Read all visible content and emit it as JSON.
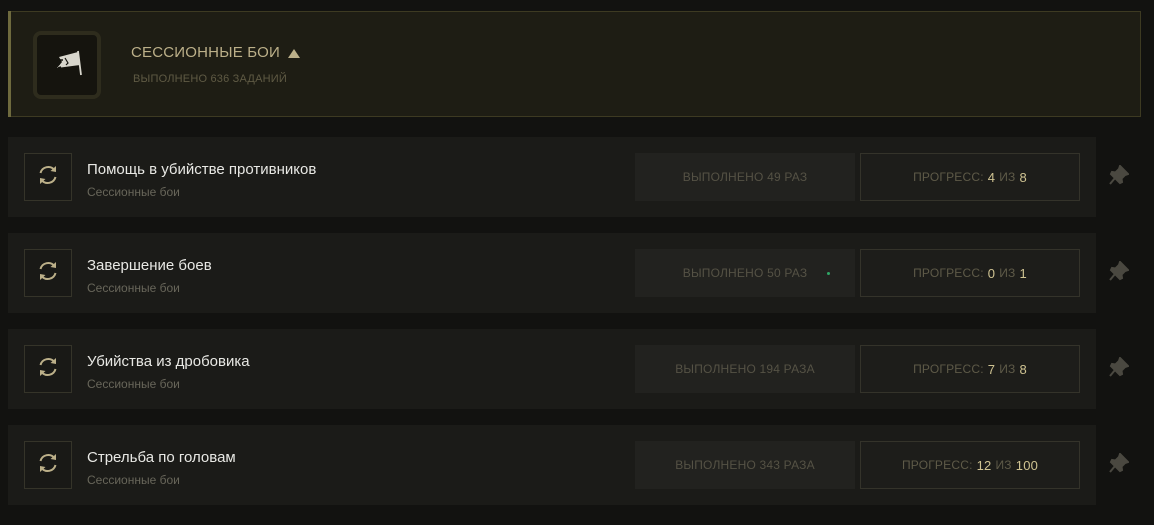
{
  "colors": {
    "accent_gold": "#bcb089",
    "progress_value": "#cfc392",
    "green_dot": "#2fa565"
  },
  "header": {
    "icon": "banner-flag-icon",
    "title": "СЕССИОННЫЕ БОИ",
    "subtitle": "ВЫПОЛНЕНО 636 ЗАДАНИЙ"
  },
  "tasks": [
    {
      "name": "Помощь в убийстве противников",
      "category": "Сессионные бои",
      "completed": "ВЫПОЛНЕНО 49 РАЗ",
      "progress_label": "ПРОГРЕСС:",
      "progress_current": "4",
      "progress_of": "ИЗ",
      "progress_total": "8",
      "new_indicator": false
    },
    {
      "name": "Завершение боев",
      "category": "Сессионные бои",
      "completed": "ВЫПОЛНЕНО 50 РАЗ",
      "progress_label": "ПРОГРЕСС:",
      "progress_current": "0",
      "progress_of": "ИЗ",
      "progress_total": "1",
      "new_indicator": true
    },
    {
      "name": "Убийства из дробовика",
      "category": "Сессионные бои",
      "completed": "ВЫПОЛНЕНО 194 РАЗА",
      "progress_label": "ПРОГРЕСС:",
      "progress_current": "7",
      "progress_of": "ИЗ",
      "progress_total": "8",
      "new_indicator": false
    },
    {
      "name": "Стрельба по головам",
      "category": "Сессионные бои",
      "completed": "ВЫПОЛНЕНО 343 РАЗА",
      "progress_label": "ПРОГРЕСС:",
      "progress_current": "12",
      "progress_of": "ИЗ",
      "progress_total": "100",
      "new_indicator": false
    }
  ]
}
